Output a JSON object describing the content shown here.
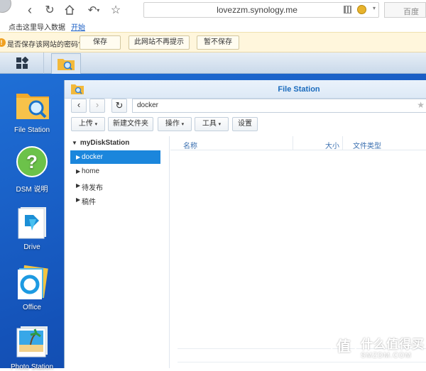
{
  "browser": {
    "url": "lovezzm.synology.me",
    "search_engine": "百度",
    "bookmarks_text": "点击这里导入数据",
    "bookmarks_link": "开始"
  },
  "password_bar": {
    "prompt": "是否保存该网站的密码?",
    "save": "保存",
    "never": "此网站不再提示",
    "not_now": "暂不保存"
  },
  "desktop": {
    "items": [
      {
        "label": "File Station",
        "icon": "folder-search-icon"
      },
      {
        "label": "DSM 说明",
        "icon": "help-icon"
      },
      {
        "label": "Drive",
        "icon": "drive-icon"
      },
      {
        "label": "Office",
        "icon": "office-icon"
      },
      {
        "label": "Photo Station",
        "icon": "photo-icon"
      }
    ]
  },
  "window": {
    "title": "File Station",
    "path": "docker",
    "toolbar": {
      "upload": "上传",
      "new_folder": "新建文件夹",
      "action": "操作",
      "tools": "工具",
      "settings": "设置"
    },
    "tree": {
      "root": "myDiskStation",
      "items": [
        "docker",
        "home",
        "待发布",
        "稿件"
      ]
    },
    "columns": [
      "名称",
      "大小",
      "文件类型"
    ]
  },
  "watermark": {
    "circle": "值",
    "top": "什么值得买",
    "bottom": "SMZDM.COM"
  },
  "colors": {
    "accent": "#1b86dc",
    "desktop": "#1452b8",
    "title": "#1a6bbd"
  }
}
